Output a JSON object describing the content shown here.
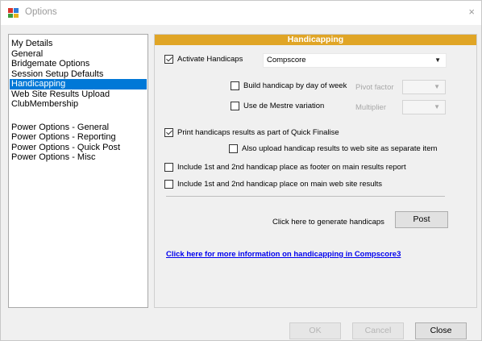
{
  "window": {
    "title": "Options",
    "app_icon": "options-app-icon",
    "close_glyph": "×"
  },
  "nav": {
    "group1": [
      {
        "label": "My Details",
        "selected": false
      },
      {
        "label": "General",
        "selected": false
      },
      {
        "label": "Bridgemate Options",
        "selected": false
      },
      {
        "label": "Session Setup Defaults",
        "selected": false
      },
      {
        "label": "Handicapping",
        "selected": true
      },
      {
        "label": "Web Site Results Upload",
        "selected": false
      },
      {
        "label": "ClubMembership",
        "selected": false
      }
    ],
    "group2": [
      {
        "label": "Power Options - General",
        "selected": false
      },
      {
        "label": "Power Options - Reporting",
        "selected": false
      },
      {
        "label": "Power Options - Quick Post",
        "selected": false
      },
      {
        "label": "Power Options - Misc",
        "selected": false
      }
    ],
    "selected_color": "#0078d7"
  },
  "panel": {
    "header": "Handicapping",
    "header_color": "#e0a526",
    "activate": {
      "label": "Activate Handicaps",
      "checked": true
    },
    "method_select": {
      "value": "Compscore"
    },
    "build_by_day": {
      "label": "Build handicap by day of week",
      "checked": false
    },
    "pivot_factor_label": "Pivot factor",
    "pivot_factor_select": {
      "value": ""
    },
    "de_mestre": {
      "label": "Use de Mestre variation",
      "checked": false
    },
    "multiplier_label": "Multiplier",
    "multiplier_select": {
      "value": ""
    },
    "print_results": {
      "label": "Print handicaps results as part of Quick Finalise",
      "checked": true
    },
    "upload_separate": {
      "label": "Also upload handicap results to web site as separate item",
      "checked": false
    },
    "footer_report": {
      "label": "Include 1st and 2nd handicap place as footer on main results report",
      "checked": false
    },
    "web_results": {
      "label": "Include 1st and 2nd handicap place on main web site results",
      "checked": false
    },
    "generate_label": "Click here to generate handicaps",
    "post_button": "Post",
    "info_link": "Click here for more information on handicapping in Compscore3"
  },
  "footer": {
    "ok_button": "OK",
    "cancel_button": "Cancel",
    "close_button": "Close"
  }
}
